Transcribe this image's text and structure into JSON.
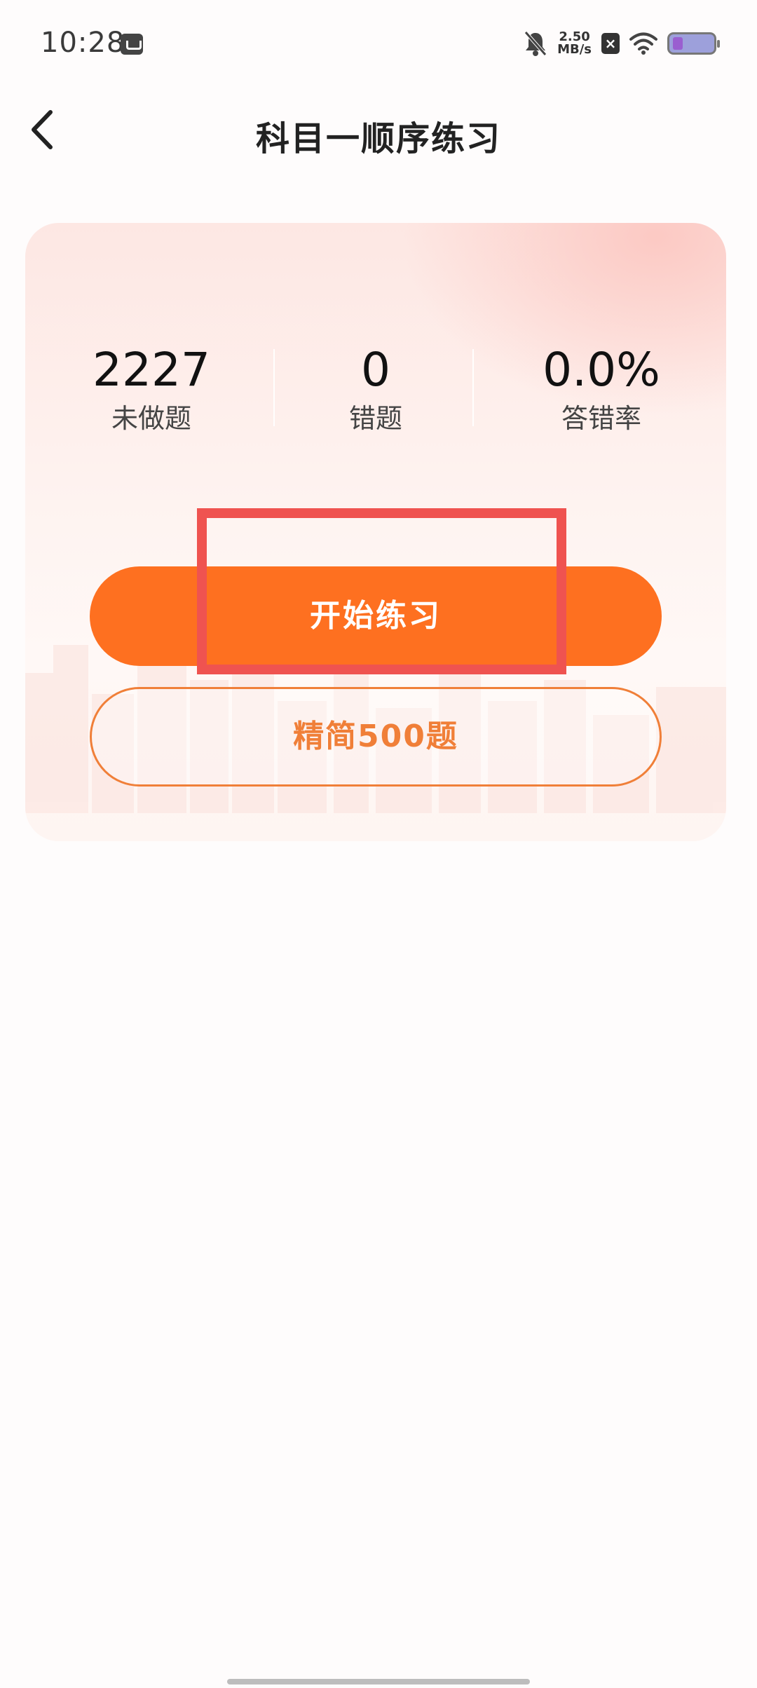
{
  "status_bar": {
    "time": "10:28",
    "net_speed_value": "2.50",
    "net_speed_unit": "MB/s",
    "icons": [
      "app-icon",
      "bell-muted-icon",
      "close-box-icon",
      "wifi-icon",
      "battery-icon"
    ]
  },
  "header": {
    "title": "科目一顺序练习",
    "back_icon": "chevron-left-icon"
  },
  "stats": [
    {
      "value": "2227",
      "label": "未做题"
    },
    {
      "value": "0",
      "label": "错题"
    },
    {
      "value": "0.0%",
      "label": "答错率"
    }
  ],
  "actions": {
    "start_label": "开始练习",
    "lite_label": "精简500题"
  },
  "colors": {
    "accent": "#fe7020",
    "outline": "#f07f38",
    "highlight": "#ef5350"
  }
}
